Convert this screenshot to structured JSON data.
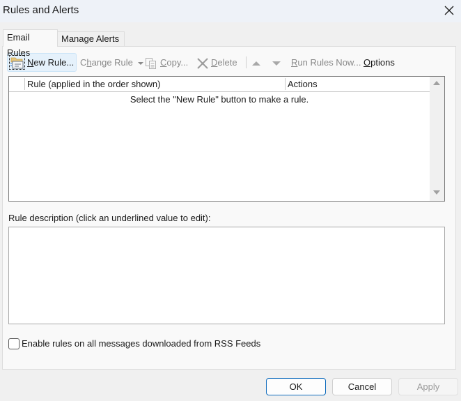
{
  "window": {
    "title": "Rules and Alerts",
    "close_icon": "close-icon"
  },
  "tabs": [
    {
      "label": "Email Rules",
      "active": true
    },
    {
      "label": "Manage Alerts",
      "active": false
    }
  ],
  "toolbar": {
    "new_rule": {
      "label": "New Rule...",
      "icon": "new-rule-envelope-icon",
      "enabled": true
    },
    "change_rule": {
      "label": "Change Rule",
      "icon": "chevron-down-icon",
      "enabled": false
    },
    "copy": {
      "label": "Copy...",
      "icon": "copy-icon",
      "enabled": false
    },
    "delete": {
      "label": "Delete",
      "icon": "delete-x-icon",
      "enabled": false
    },
    "move_up": {
      "icon": "triangle-up-icon",
      "enabled": false
    },
    "move_down": {
      "icon": "triangle-down-icon",
      "enabled": false
    },
    "run_rules_now": {
      "label": "Run Rules Now...",
      "enabled": false
    },
    "options": {
      "label": "Options",
      "enabled": true
    }
  },
  "rules_list": {
    "columns": [
      "Rule (applied in the order shown)",
      "Actions"
    ],
    "rows": [],
    "empty_message": "Select the \"New Rule\" button to make a rule."
  },
  "rule_description": {
    "label": "Rule description (click an underlined value to edit):",
    "content": ""
  },
  "rss_option": {
    "label": "Enable rules on all messages downloaded from RSS Feeds",
    "checked": false
  },
  "buttons": {
    "ok": "OK",
    "cancel": "Cancel",
    "apply": "Apply"
  },
  "colors": {
    "titlebar_bg": "#eef2f8",
    "accent_border": "#0f6cbd",
    "new_rule_highlight": "#e5f1fb",
    "disabled_text": "#8a8a8a"
  }
}
